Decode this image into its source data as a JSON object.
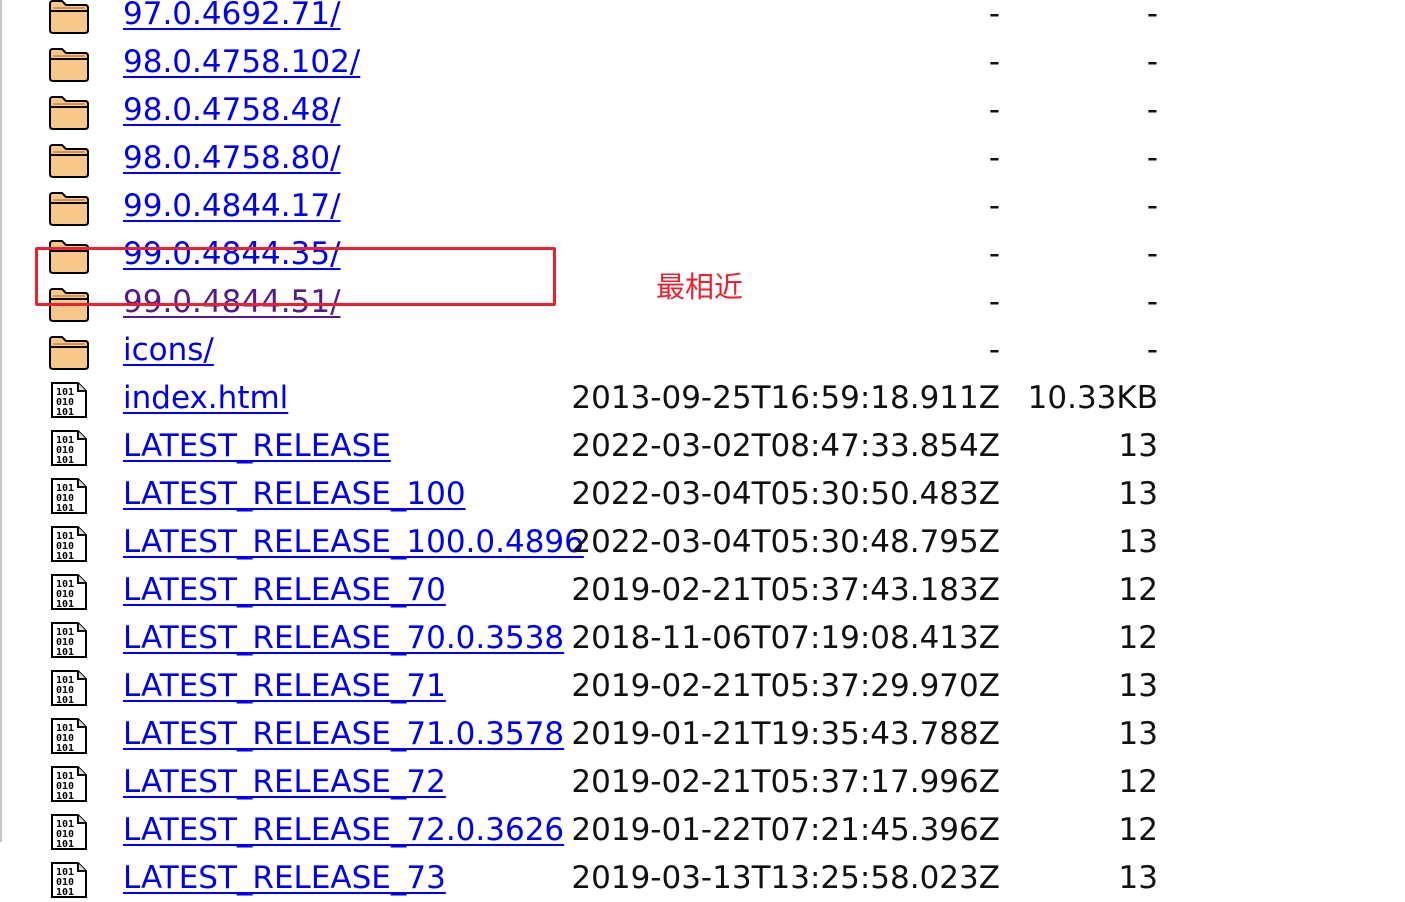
{
  "listing": {
    "rows": [
      {
        "type": "folder",
        "name": "97.0.4692.71/",
        "date": "-",
        "size": "-"
      },
      {
        "type": "folder",
        "name": "98.0.4758.102/",
        "date": "-",
        "size": "-"
      },
      {
        "type": "folder",
        "name": "98.0.4758.48/",
        "date": "-",
        "size": "-"
      },
      {
        "type": "folder",
        "name": "98.0.4758.80/",
        "date": "-",
        "size": "-"
      },
      {
        "type": "folder",
        "name": "99.0.4844.17/",
        "date": "-",
        "size": "-"
      },
      {
        "type": "folder",
        "name": "99.0.4844.35/",
        "date": "-",
        "size": "-"
      },
      {
        "type": "folder",
        "name": "99.0.4844.51/",
        "date": "-",
        "size": "-",
        "visited": true
      },
      {
        "type": "folder",
        "name": "icons/",
        "date": "-",
        "size": "-"
      },
      {
        "type": "file",
        "name": "index.html",
        "date": "2013-09-25T16:59:18.911Z",
        "size": "10.33KB"
      },
      {
        "type": "file",
        "name": "LATEST_RELEASE",
        "date": "2022-03-02T08:47:33.854Z",
        "size": "13"
      },
      {
        "type": "file",
        "name": "LATEST_RELEASE_100",
        "date": "2022-03-04T05:30:50.483Z",
        "size": "13"
      },
      {
        "type": "file",
        "name": "LATEST_RELEASE_100.0.4896",
        "date": "2022-03-04T05:30:48.795Z",
        "size": "13"
      },
      {
        "type": "file",
        "name": "LATEST_RELEASE_70",
        "date": "2019-02-21T05:37:43.183Z",
        "size": "12"
      },
      {
        "type": "file",
        "name": "LATEST_RELEASE_70.0.3538",
        "date": "2018-11-06T07:19:08.413Z",
        "size": "12"
      },
      {
        "type": "file",
        "name": "LATEST_RELEASE_71",
        "date": "2019-02-21T05:37:29.970Z",
        "size": "13"
      },
      {
        "type": "file",
        "name": "LATEST_RELEASE_71.0.3578",
        "date": "2019-01-21T19:35:43.788Z",
        "size": "13"
      },
      {
        "type": "file",
        "name": "LATEST_RELEASE_72",
        "date": "2019-02-21T05:37:17.996Z",
        "size": "12"
      },
      {
        "type": "file",
        "name": "LATEST_RELEASE_72.0.3626",
        "date": "2019-01-22T07:21:45.396Z",
        "size": "12"
      },
      {
        "type": "file",
        "name": "LATEST_RELEASE_73",
        "date": "2019-03-13T13:25:58.023Z",
        "size": "13"
      }
    ]
  },
  "annotation": {
    "text": "最相近",
    "color": "#e8232f"
  },
  "colors": {
    "link": "#0000ee",
    "visited_link": "#551a8b",
    "folder_fill": "#f8c888",
    "highlight_border": "#e8232f"
  }
}
